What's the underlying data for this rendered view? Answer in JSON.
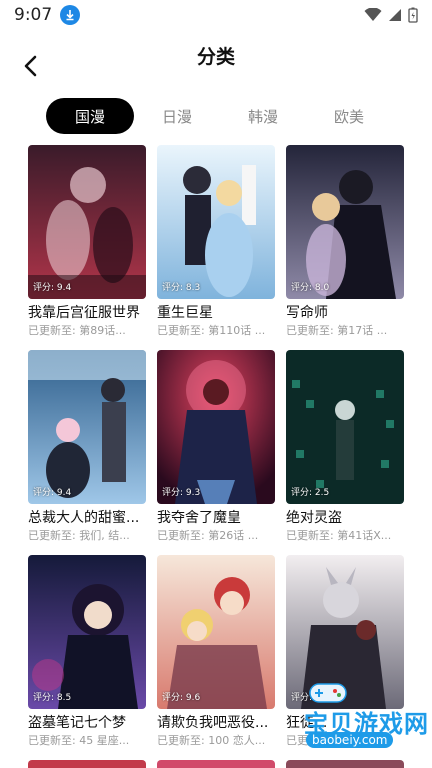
{
  "status": {
    "time": "9:07"
  },
  "header": {
    "title": "分类"
  },
  "tabs": [
    {
      "label": "国漫",
      "active": true
    },
    {
      "label": "日漫",
      "active": false
    },
    {
      "label": "韩漫",
      "active": false
    },
    {
      "label": "欧美",
      "active": false
    }
  ],
  "comics": [
    {
      "title": "我靠后宫征服世界",
      "score": "评分: 9.4",
      "update": "已更新至: 第89话...",
      "c1": "#3a1b2a",
      "c2": "#b2354a"
    },
    {
      "title": "重生巨星",
      "score": "评分: 8.3",
      "update": "已更新至: 第110话 ...",
      "c1": "#cfe6f6",
      "c2": "#7fb3dc"
    },
    {
      "title": "写命师",
      "score": "评分: 8.0",
      "update": "已更新至: 第17话 ...",
      "c1": "#24253a",
      "c2": "#8f8aa8"
    },
    {
      "title": "总裁大人的甜蜜...",
      "score": "评分: 9.4",
      "update": "已更新至: 我们, 结...",
      "c1": "#2d5d8a",
      "c2": "#9fc7e8"
    },
    {
      "title": "我夺舍了魔皇",
      "score": "评分: 9.3",
      "update": "已更新至: 第26话 ...",
      "c1": "#5b0f2e",
      "c2": "#e0415e"
    },
    {
      "title": "绝对灵盗",
      "score": "评分: 2.5",
      "update": "已更新至: 第41话X...",
      "c1": "#0c3a33",
      "c2": "#2fae8f"
    },
    {
      "title": "盗墓笔记七个梦",
      "score": "评分: 8.5",
      "update": "已更新至: 45 星座...",
      "c1": "#151a3a",
      "c2": "#6a4aa8"
    },
    {
      "title": "请欺负我吧恶役...",
      "score": "评分: 9.6",
      "update": "已更新至: 100 恋人...",
      "c1": "#f2d9c7",
      "c2": "#d87a6e"
    },
    {
      "title": "狂徒...",
      "score": "评分: ...",
      "update": "已更新至: ...节快...",
      "c1": "#ece6e8",
      "c2": "#6c6a78"
    }
  ],
  "watermark": {
    "text": "宝贝游戏网",
    "url": "baobeiy.com"
  }
}
